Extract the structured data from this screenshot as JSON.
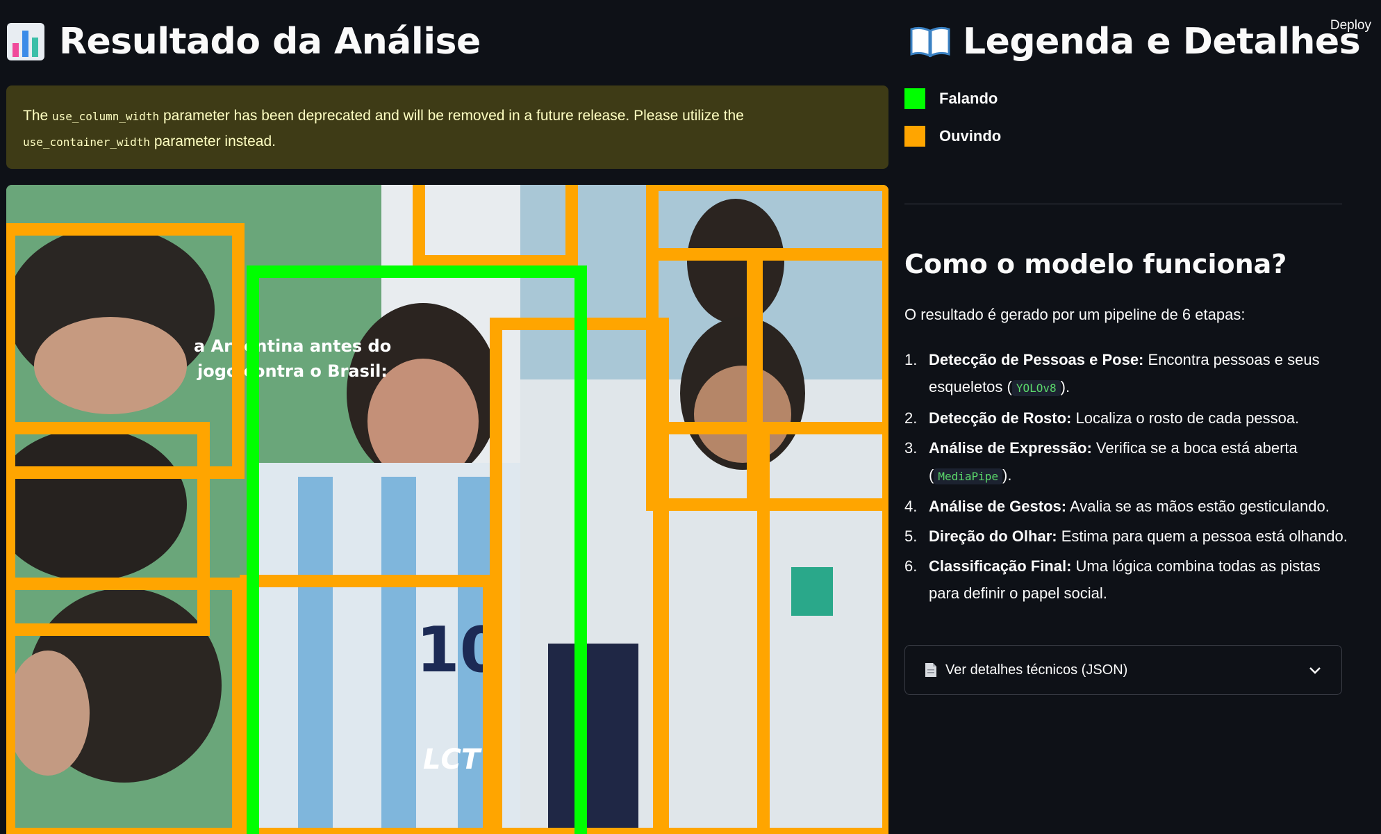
{
  "header": {
    "deploy_label": "Deploy"
  },
  "left": {
    "title": "Resultado da Análise",
    "title_icon": "bar-chart-icon",
    "warning": {
      "part1": "The",
      "code1": "use_column_width",
      "part2": "parameter has been deprecated and will be removed in a future release. Please utilize the",
      "code2": "use_container_width",
      "part3": "parameter instead."
    },
    "image": {
      "overlay_line1": "a Argentina antes do",
      "overlay_line2": "jogo contra o Brasil:",
      "watermark": "LCT",
      "jersey_number": "10"
    }
  },
  "right": {
    "title": "Legenda e Detalhes",
    "title_icon": "open-book-icon",
    "legend": [
      {
        "label": "Falando",
        "color": "#00ff00"
      },
      {
        "label": "Ouvindo",
        "color": "#ffa500"
      }
    ],
    "section_title": "Como o modelo funciona?",
    "intro": "O resultado é gerado por um pipeline de 6 etapas:",
    "steps": [
      {
        "n": "1.",
        "bold": "Detecção de Pessoas e Pose:",
        "text": "Encontra pessoas e seus esqueletos (",
        "code": "YOLOv8",
        "after": ")."
      },
      {
        "n": "2.",
        "bold": "Detecção de Rosto:",
        "text": "Localiza o rosto de cada pessoa.",
        "code": "",
        "after": ""
      },
      {
        "n": "3.",
        "bold": "Análise de Expressão:",
        "text": "Verifica se a boca está aberta (",
        "code": "MediaPipe",
        "after": ")."
      },
      {
        "n": "4.",
        "bold": "Análise de Gestos:",
        "text": "Avalia se as mãos estão gesticulando.",
        "code": "",
        "after": ""
      },
      {
        "n": "5.",
        "bold": "Direção do Olhar:",
        "text": "Estima para quem a pessoa está olhando.",
        "code": "",
        "after": ""
      },
      {
        "n": "6.",
        "bold": "Classificação Final:",
        "text": "Uma lógica combina todas as pistas para definir o papel social.",
        "code": "",
        "after": ""
      }
    ],
    "expander_label": "Ver detalhes técnicos (JSON)",
    "expander_icon": "document-icon",
    "expander_chevron": "chevron-down-icon"
  }
}
